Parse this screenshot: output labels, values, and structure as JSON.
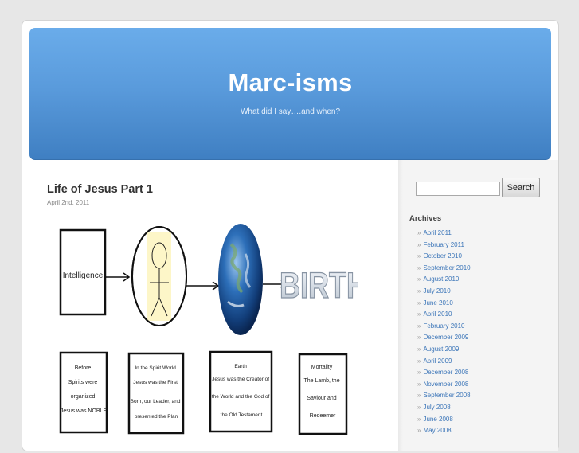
{
  "header": {
    "title": "Marc-isms",
    "tagline": "What did I say….and when?"
  },
  "post": {
    "title": "Life of Jesus Part 1",
    "date": "April 2nd, 2011",
    "diagram": {
      "stage1_label": "Intelligence",
      "stage4_label": "BIRTH",
      "box1": [
        "Before",
        "Spirits were",
        "organized",
        "Jesus was NOBLE"
      ],
      "box2": [
        "In the Spirit World",
        "Jesus was the First",
        "Born, our Leader, and",
        "presented the Plan"
      ],
      "box3": [
        "Earth",
        "Jesus was the Creator of",
        "the World and the God of",
        "the Old Testament"
      ],
      "box4": [
        "Mortality",
        "The Lamb, the",
        "Saviour and",
        "Redeemer"
      ]
    }
  },
  "sidebar": {
    "search_button": "Search",
    "search_value": "",
    "archives_heading": "Archives",
    "archives": [
      "April 2011",
      "February 2011",
      "October 2010",
      "September 2010",
      "August 2010",
      "July 2010",
      "June 2010",
      "April 2010",
      "February 2010",
      "December 2009",
      "August 2009",
      "April 2009",
      "December 2008",
      "November 2008",
      "September 2008",
      "July 2008",
      "June 2008",
      "May 2008"
    ]
  },
  "colors": {
    "header_top": "#6aacea",
    "header_bottom": "#3f7fc2",
    "link": "#3b75b8"
  }
}
